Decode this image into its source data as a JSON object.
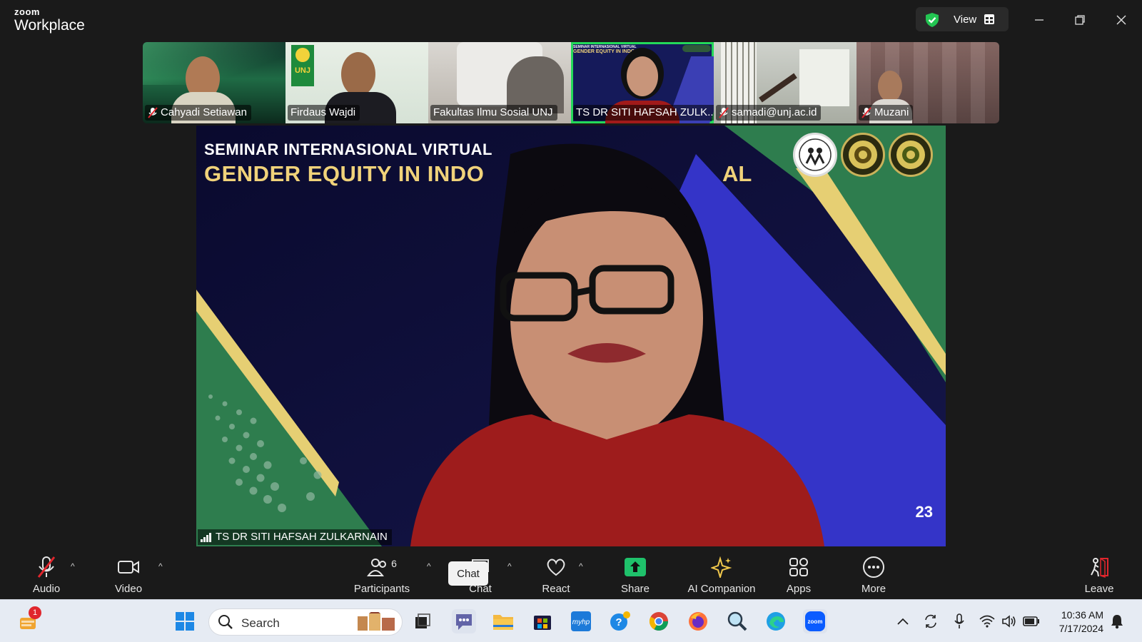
{
  "app": {
    "brand_small": "zoom",
    "brand_big": "Workplace"
  },
  "titlebar": {
    "view_label": "View"
  },
  "participants_strip": [
    {
      "name": "Cahyadi Setiawan",
      "muted": true
    },
    {
      "name": "Firdaus Wajdi",
      "muted": false
    },
    {
      "name": "Fakultas Ilmu Sosial UNJ",
      "muted": false
    },
    {
      "name": "TS DR SITI HAFSAH ZULK...",
      "muted": false,
      "active": true
    },
    {
      "name": "samadi@unj.ac.id",
      "muted": true
    },
    {
      "name": "Muzani",
      "muted": true
    }
  ],
  "thumb_text": {
    "unj_badge": "UNJ",
    "slide_mini_line1": "SEMINAR INTERNASIONAL VIRTUAL",
    "slide_mini_line2": "GENDER EQUITY IN INDO"
  },
  "main_video": {
    "speaker_name": "TS DR SITI HAFSAH ZULKARNAIN",
    "slide_title_line1": "SEMINAR INTERNASIONAL VIRTUAL",
    "slide_title_line2": "GENDER EQUITY IN INDO",
    "slide_title_tail": "AL",
    "slide_year": "23"
  },
  "toolbar": {
    "audio": "Audio",
    "video": "Video",
    "participants": "Participants",
    "participants_count": "6",
    "chat": "Chat",
    "chat_tooltip": "Chat",
    "react": "React",
    "share": "Share",
    "ai_companion": "AI Companion",
    "apps": "Apps",
    "more": "More",
    "leave": "Leave"
  },
  "taskbar": {
    "search_placeholder": "Search",
    "notification_count": "1",
    "time": "10:36 AM",
    "date": "7/17/2024"
  },
  "colors": {
    "active_border": "#23d959",
    "share_green": "#1fc16b",
    "leave_red": "#e0262d"
  }
}
